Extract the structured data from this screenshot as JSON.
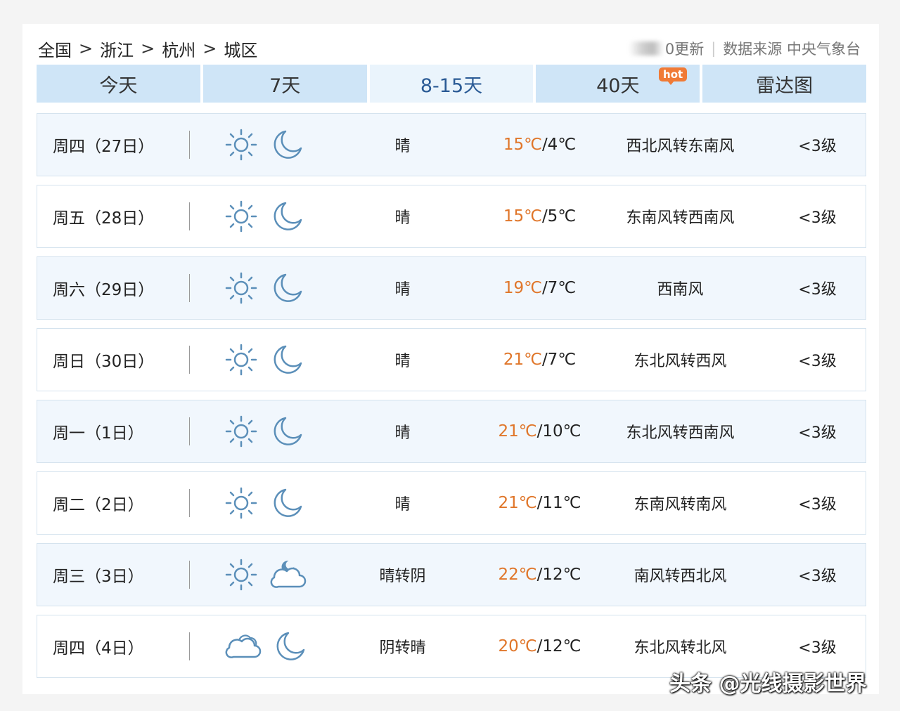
{
  "breadcrumb": [
    "全国",
    "浙江",
    "杭州",
    "城区"
  ],
  "breadcrumb_separator": ">",
  "source": {
    "update_text": "0更新",
    "divider": "|",
    "label": "数据来源 中央气象台"
  },
  "tabs": [
    {
      "label": "今天"
    },
    {
      "label": "7天"
    },
    {
      "label": "8-15天"
    },
    {
      "label": "40天",
      "badge": "hot"
    },
    {
      "label": "雷达图"
    }
  ],
  "active_tab": "8-15天",
  "days": [
    {
      "date": "周四（27日）",
      "day_icon": "sun-icon",
      "night_icon": "moon-icon",
      "condition": "晴",
      "high": "15℃",
      "low": "/4℃",
      "wind": "西北风转东南风",
      "level": "<3级"
    },
    {
      "date": "周五（28日）",
      "day_icon": "sun-icon",
      "night_icon": "moon-icon",
      "condition": "晴",
      "high": "15℃",
      "low": "/5℃",
      "wind": "东南风转西南风",
      "level": "<3级"
    },
    {
      "date": "周六（29日）",
      "day_icon": "sun-icon",
      "night_icon": "moon-icon",
      "condition": "晴",
      "high": "19℃",
      "low": "/7℃",
      "wind": "西南风",
      "level": "<3级"
    },
    {
      "date": "周日（30日）",
      "day_icon": "sun-icon",
      "night_icon": "moon-icon",
      "condition": "晴",
      "high": "21℃",
      "low": "/7℃",
      "wind": "东北风转西风",
      "level": "<3级"
    },
    {
      "date": "周一（1日）",
      "day_icon": "sun-icon",
      "night_icon": "moon-icon",
      "condition": "晴",
      "high": "21℃",
      "low": "/10℃",
      "wind": "东北风转西南风",
      "level": "<3级"
    },
    {
      "date": "周二（2日）",
      "day_icon": "sun-icon",
      "night_icon": "moon-icon",
      "condition": "晴",
      "high": "21℃",
      "low": "/11℃",
      "wind": "东南风转南风",
      "level": "<3级"
    },
    {
      "date": "周三（3日）",
      "day_icon": "sun-icon",
      "night_icon": "cloudy-night-icon",
      "condition": "晴转阴",
      "high": "22℃",
      "low": "/12℃",
      "wind": "南风转西北风",
      "level": "<3级"
    },
    {
      "date": "周四（4日）",
      "day_icon": "cloud-icon",
      "night_icon": "moon-icon",
      "condition": "阴转晴",
      "high": "20℃",
      "low": "/12℃",
      "wind": "东北风转北风",
      "level": "<3级"
    }
  ],
  "colors": {
    "tab_bg": "#cfe5f7",
    "tab_active_bg": "#eaf4fc",
    "tab_active_text": "#2a5a95",
    "high_temp": "#e0762a",
    "icon_stroke": "#5b8fb9",
    "hot_badge": "#f07a36"
  },
  "watermark": "头条 @光线摄影世界"
}
